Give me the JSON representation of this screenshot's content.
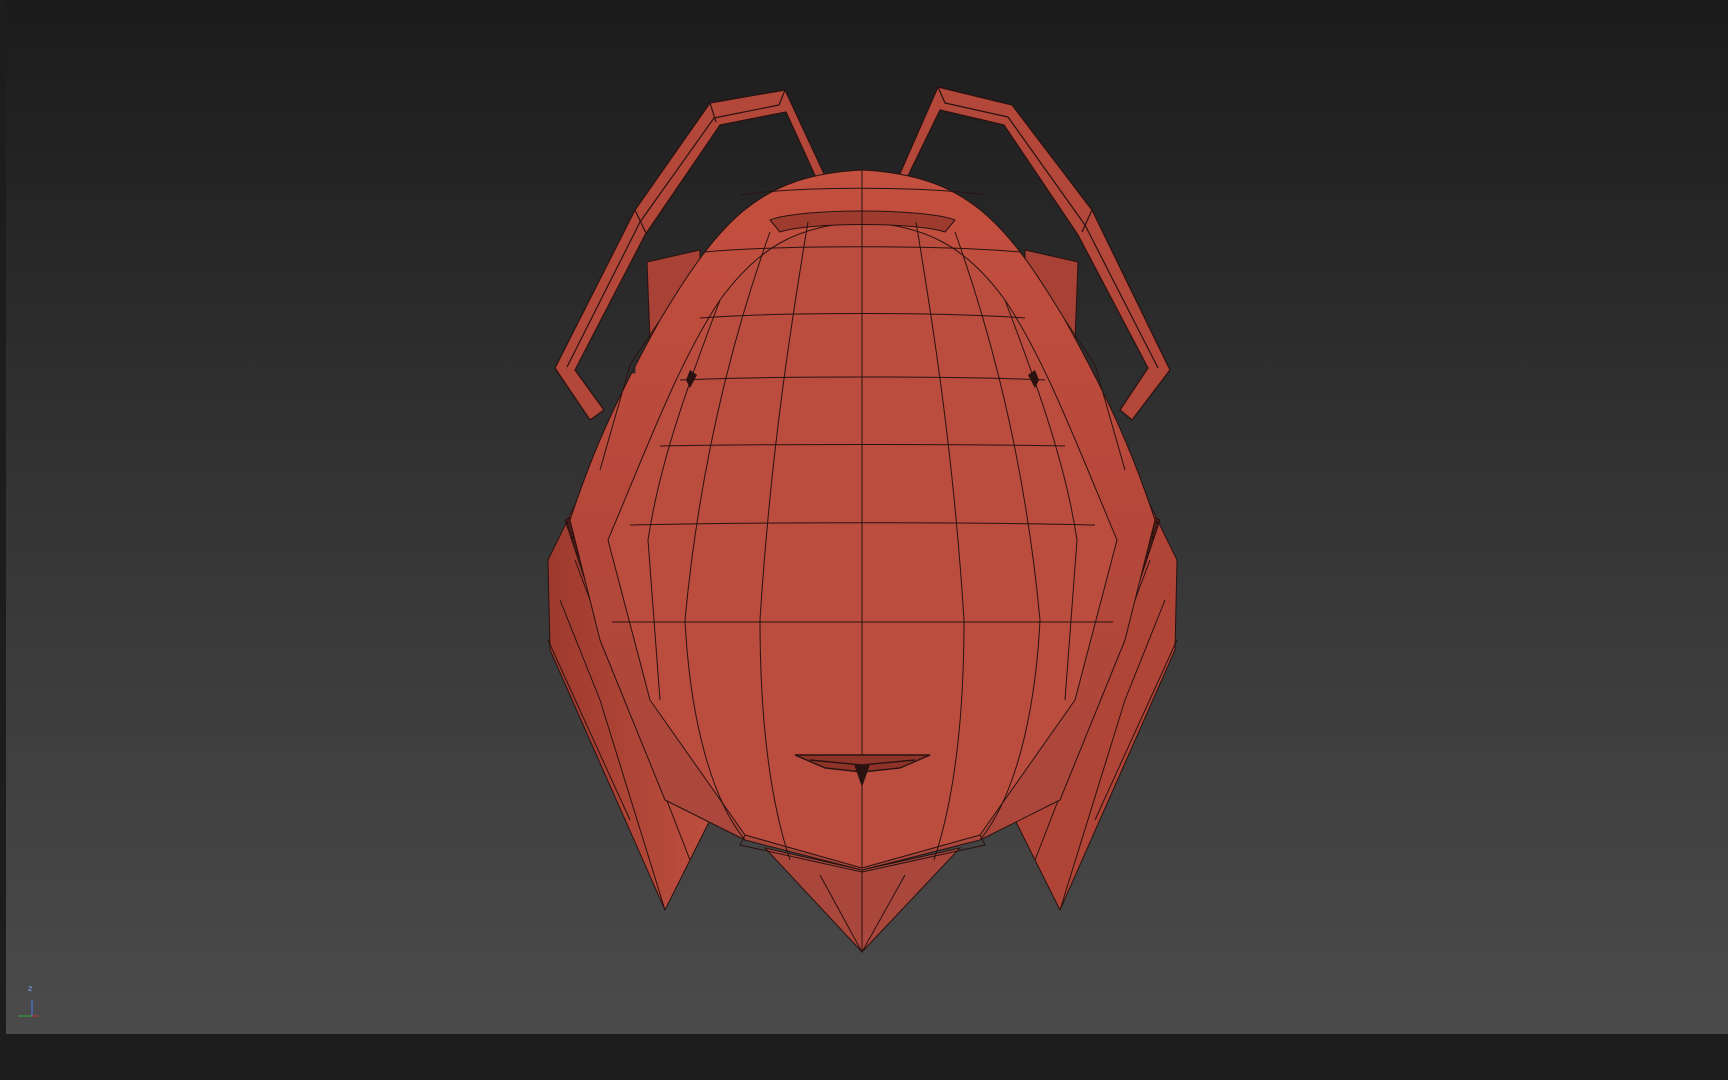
{
  "viewport": {
    "name": "3d-viewport",
    "background_top": "#1b1b1b",
    "background_bottom": "#4b4b4b"
  },
  "model": {
    "name": "helmet-wireframe-model",
    "shade_color": "#b5473a",
    "shade_light": "#c95a4a",
    "shade_dark": "#8e3328",
    "wire_color": "#2a1210"
  },
  "axis_gizmo": {
    "z_label": "z",
    "z_color": "#4b7bff",
    "x_color": "#d33",
    "y_color": "#3a3"
  }
}
